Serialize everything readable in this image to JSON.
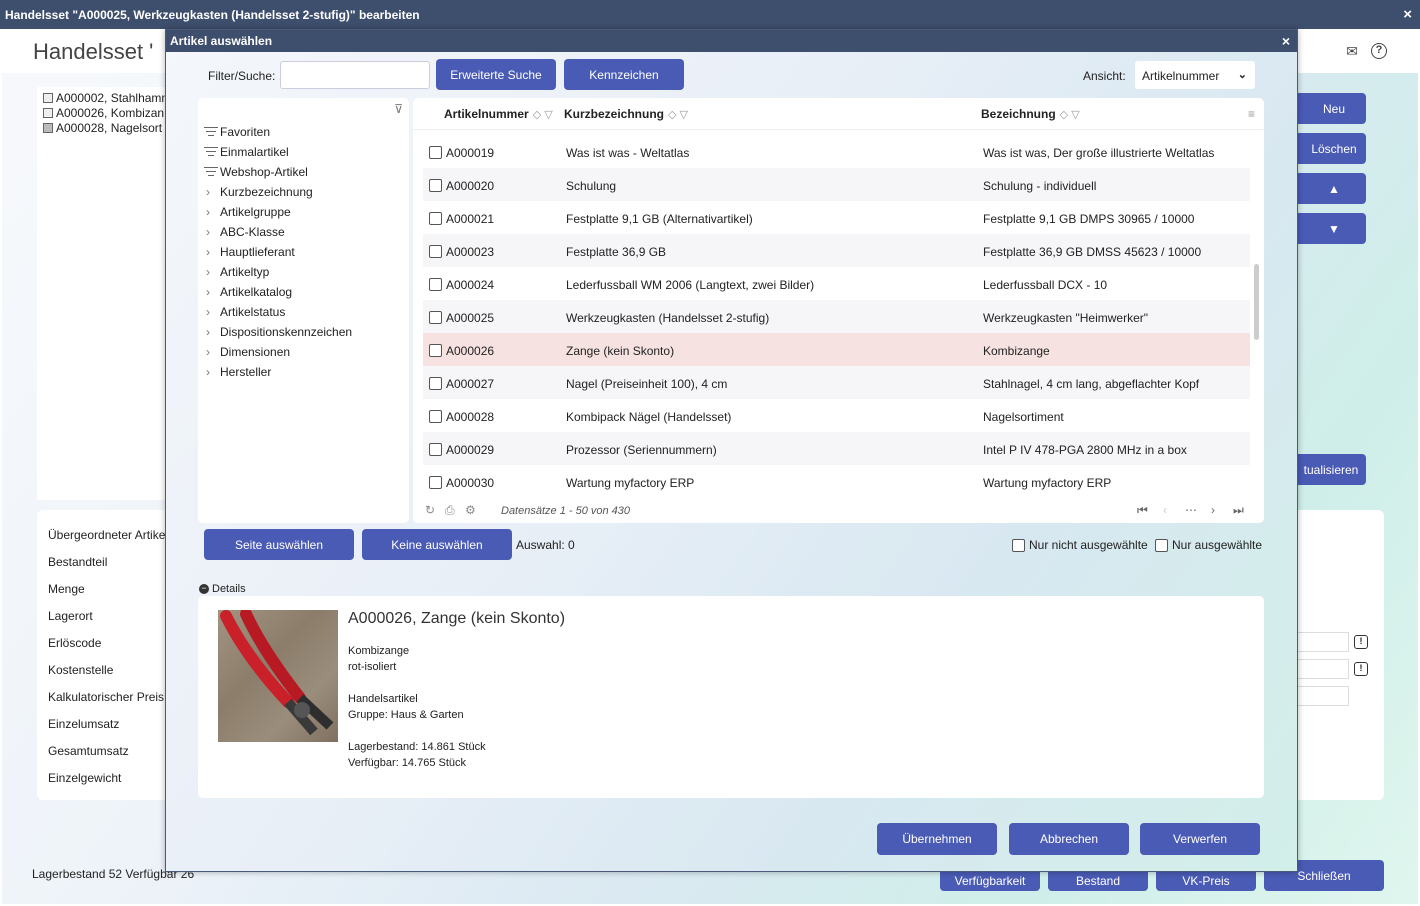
{
  "outer": {
    "title": "Handelsset \"A000025, Werkzeugkasten (Handelsset 2-stufig)\" bearbeiten",
    "close": "×",
    "page_title": "Handelsset '",
    "tree": [
      "A000002, Stahlhamm",
      "A000026, Kombizan",
      "A000028, Nagelsort"
    ],
    "right_buttons": [
      "Neu",
      "Löschen",
      "▲",
      "▼",
      "tualisieren"
    ],
    "fields": [
      "Übergeordneter Artike",
      "Bestandteil",
      "Menge",
      "Lagerort",
      "Erlöscode",
      "Kostenstelle",
      "Kalkulatorischer Preis",
      "Einzelumsatz",
      "Gesamtumsatz",
      "Einzelgewicht"
    ],
    "status": "Lagerbestand 52 Verfügbar 26",
    "bottom_buttons": [
      "Verfügbarkeit",
      "Bestand",
      "VK-Preis",
      "Schließen"
    ]
  },
  "modal": {
    "title": "Artikel auswählen",
    "close": "×",
    "filter_label": "Filter/Suche:",
    "filter_value": "",
    "btn_extended_search": "Erweiterte Suche",
    "btn_flags": "Kennzeichen",
    "view_label": "Ansicht:",
    "view_value": "Artikelnummer",
    "filter_tree": {
      "lists": [
        "Favoriten",
        "Einmalartikel",
        "Webshop-Artikel"
      ],
      "groups": [
        "Kurzbezeichnung",
        "Artikelgruppe",
        "ABC-Klasse",
        "Hauptlieferant",
        "Artikeltyp",
        "Artikelkatalog",
        "Artikelstatus",
        "Dispositionskennzeichen",
        "Dimensionen",
        "Hersteller"
      ]
    },
    "grid": {
      "columns": [
        "Artikelnummer",
        "Kurzbezeichnung",
        "Bezeichnung"
      ],
      "rows": [
        {
          "nr": "A000019",
          "kurz": "Was ist was - Weltatlas",
          "bez": "Was ist was, Der große illustrierte Weltatlas"
        },
        {
          "nr": "A000020",
          "kurz": "Schulung",
          "bez": "Schulung - individuell"
        },
        {
          "nr": "A000021",
          "kurz": "Festplatte 9,1 GB (Alternativartikel)",
          "bez": "Festplatte 9,1 GB DMPS 30965 / 10000"
        },
        {
          "nr": "A000023",
          "kurz": "Festplatte 36,9 GB",
          "bez": "Festplatte 36,9 GB DMSS 45623 / 10000"
        },
        {
          "nr": "A000024",
          "kurz": "Lederfussball WM 2006 (Langtext, zwei Bilder)",
          "bez": "Lederfussball DCX - 10"
        },
        {
          "nr": "A000025",
          "kurz": "Werkzeugkasten (Handelsset 2-stufig)",
          "bez": "Werkzeugkasten \"Heimwerker\""
        },
        {
          "nr": "A000026",
          "kurz": "Zange (kein Skonto)",
          "bez": "Kombizange"
        },
        {
          "nr": "A000027",
          "kurz": "Nagel (Preiseinheit 100), 4 cm",
          "bez": "Stahlnagel, 4 cm lang, abgeflachter Kopf"
        },
        {
          "nr": "A000028",
          "kurz": "Kombipack Nägel (Handelsset)",
          "bez": "Nagelsortiment"
        },
        {
          "nr": "A000029",
          "kurz": "Prozessor (Seriennummern)",
          "bez": "Intel P IV 478-PGA 2800 MHz in a box"
        },
        {
          "nr": "A000030",
          "kurz": "Wartung myfactory ERP",
          "bez": "Wartung myfactory ERP"
        }
      ],
      "selected_nr": "A000026",
      "records": "Datensätze 1 - 50 von 430"
    },
    "btn_select_page": "Seite auswählen",
    "btn_select_none": "Keine auswählen",
    "selection": "Auswahl: 0",
    "only_unselected": "Nur nicht ausgewählte",
    "only_selected": "Nur ausgewählte",
    "details_label": "Details",
    "details": {
      "title": "A000026, Zange (kein Skonto)",
      "lines": [
        "Kombizange",
        "rot-isoliert",
        "",
        "Handelsartikel",
        "Gruppe: Haus & Garten",
        "",
        "Lagerbestand: 14.861 Stück",
        "Verfügbar: 14.765 Stück"
      ]
    },
    "btn_apply": "Übernehmen",
    "btn_cancel": "Abbrechen",
    "btn_discard": "Verwerfen"
  },
  "colors": {
    "titlebar": "#3e4f6d",
    "button": "#4a5bb5",
    "selected_row": "#f6e3e1"
  }
}
